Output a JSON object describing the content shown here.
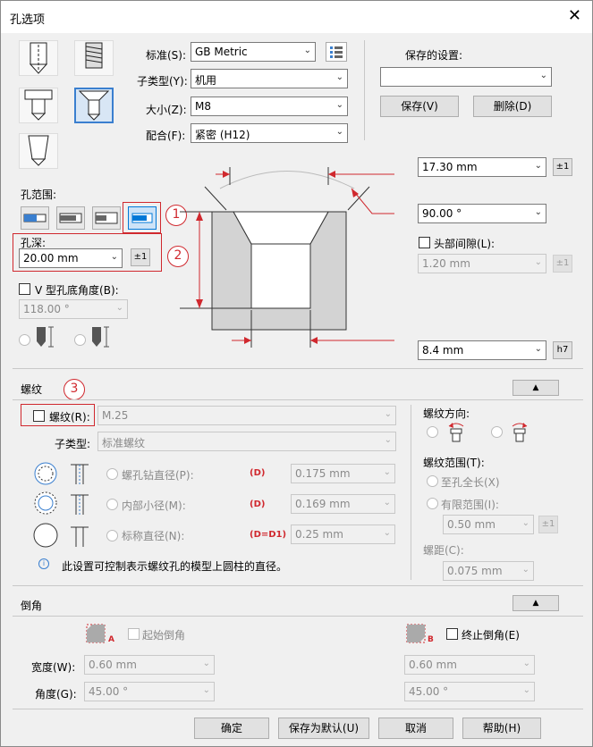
{
  "window": {
    "title": "孔选项",
    "close_glyph": "✕"
  },
  "top": {
    "standard_label": "标准(S):",
    "standard_value": "GB Metric",
    "subtype_label": "子类型(Y):",
    "subtype_value": "机用",
    "size_label": "大小(Z):",
    "size_value": "M8",
    "fit_label": "配合(F):",
    "fit_value": "紧密 (H12)",
    "saved_label": "保存的设置:",
    "saved_value": "",
    "save_button": "保存(V)",
    "delete_button": "删除(D)"
  },
  "hole_range": {
    "label": "孔范围:",
    "depth_label": "孔深:",
    "depth_value": "20.00 mm",
    "depth_tol": "±1",
    "v_angle_label": "V 型孔底角度(B):",
    "v_angle_value": "118.00 °"
  },
  "dims": {
    "top_diameter": "17.30 mm",
    "top_diameter_tol": "±1",
    "angle": "90.00 °",
    "head_clearance_label": "头部间隙(L):",
    "head_clearance_value": "1.20 mm",
    "head_clearance_tol": "±1",
    "diameter": "8.4 mm",
    "diameter_fit": "h7"
  },
  "annotations": {
    "c1": "1",
    "c2": "2",
    "c3": "3"
  },
  "thread": {
    "section": "螺纹",
    "collapse": "▲",
    "thread_label": "螺纹(R):",
    "thread_value": "M.25",
    "subtype_label": "子类型:",
    "subtype_value": "标准螺纹",
    "tap_drill_label": "螺孔钻直径(P):",
    "tap_drill_tag": "(D)",
    "tap_drill_value": "0.175 mm",
    "minor_label": "内部小径(M):",
    "minor_tag": "(D)",
    "minor_value": "0.169 mm",
    "nominal_label": "标称直径(N):",
    "nominal_tag": "(D=D1)",
    "nominal_value": "0.25 mm",
    "info": "此设置可控制表示螺纹孔的模型上圆柱的直径。",
    "direction_label": "螺纹方向:",
    "range_label": "螺纹范围(T):",
    "full_length": "至孔全长(X)",
    "finite_range": "有限范围(I):",
    "finite_value": "0.50 mm",
    "finite_tol": "±1",
    "pitch_label": "螺距(C):",
    "pitch_value": "0.075 mm"
  },
  "chamfer": {
    "section": "倒角",
    "collapse": "▲",
    "start_label": "起始倒角",
    "end_label": "终止倒角(E)",
    "tag_a": "A",
    "tag_b": "B",
    "width_label": "宽度(W):",
    "width_a": "0.60 mm",
    "width_b": "0.60 mm",
    "angle_label": "角度(G):",
    "angle_a": "45.00 °",
    "angle_b": "45.00 °"
  },
  "footer": {
    "ok": "确定",
    "save_default": "保存为默认(U)",
    "cancel": "取消",
    "help": "帮助(H)"
  },
  "colors": {
    "accent_red": "#d0282e",
    "accent_blue": "#3a7fcf"
  }
}
